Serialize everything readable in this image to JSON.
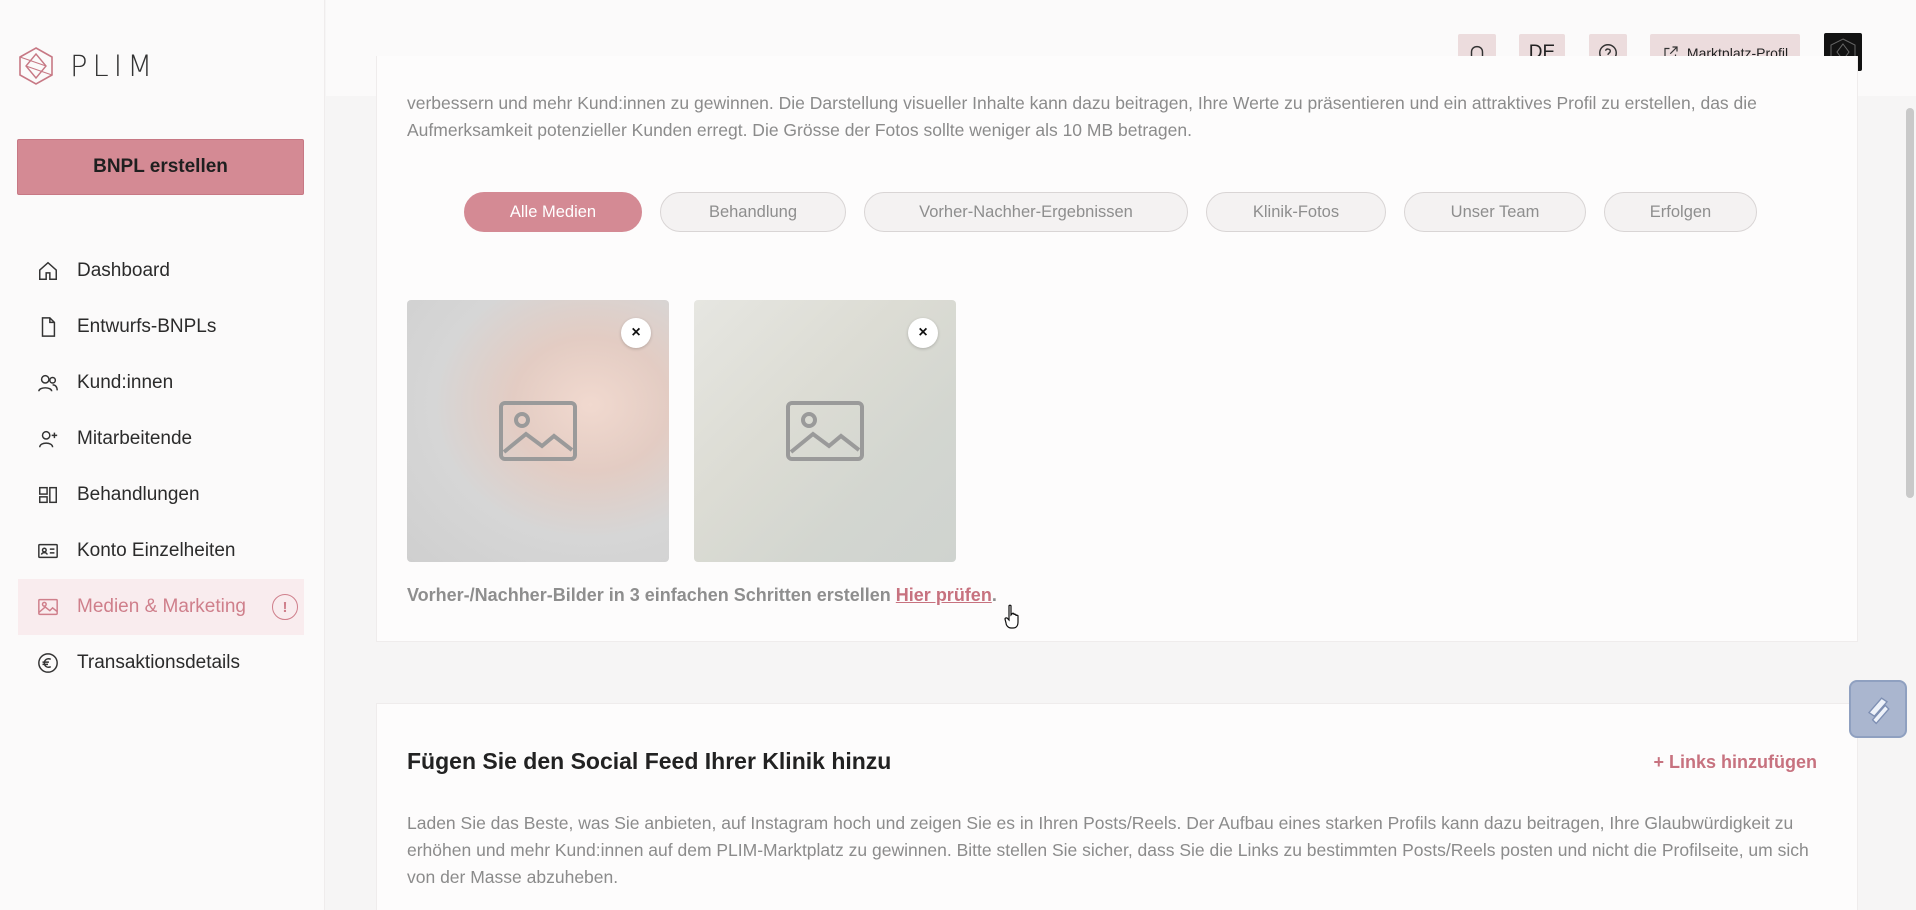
{
  "brand": {
    "name": "PLIM"
  },
  "sidebar": {
    "cta_label": "BNPL erstellen",
    "items": [
      {
        "label": "Dashboard",
        "icon": "home-icon"
      },
      {
        "label": "Entwurfs-BNPLs",
        "icon": "file-icon"
      },
      {
        "label": "Kund:innen",
        "icon": "users-icon"
      },
      {
        "label": "Mitarbeitende",
        "icon": "user-plus-icon"
      },
      {
        "label": "Behandlungen",
        "icon": "layout-icon"
      },
      {
        "label": "Konto Einzelheiten",
        "icon": "id-card-icon"
      },
      {
        "label": "Medien & Marketing",
        "icon": "image-icon",
        "active": true,
        "alert": "!"
      },
      {
        "label": "Transaktionsdetails",
        "icon": "euro-icon"
      }
    ]
  },
  "topbar": {
    "language": "DE",
    "marketplace_label": "Marktplatz-Profil"
  },
  "media": {
    "intro_text": "verbessern und mehr Kund:innen zu gewinnen. Die Darstellung visueller Inhalte kann dazu beitragen, Ihre Werte zu präsentieren und ein attraktives Profil zu erstellen, das die Aufmerksamkeit potenzieller Kunden erregt. Die Grösse der Fotos sollte weniger als 10 MB betragen.",
    "filters": [
      "Alle Medien",
      "Behandlung",
      "Vorher-Nachher-Ergebnissen",
      "Klinik-Fotos",
      "Unser Team",
      "Erfolgen"
    ],
    "active_filter": "Alle Medien",
    "remove_symbol": "×",
    "caption_text": "Vorher-/Nachher-Bilder in 3 einfachen Schritten erstellen ",
    "caption_link": "Hier prüfen",
    "caption_end": "."
  },
  "social": {
    "title": "Fügen Sie den Social Feed Ihrer Klinik hinzu",
    "add_links_label": "+ Links hinzufügen",
    "description": "Laden Sie das Beste, was Sie anbieten, auf Instagram hoch und zeigen Sie es in Ihren Posts/Reels. Der Aufbau eines starken Profils kann dazu beitragen, Ihre Glaubwürdigkeit zu erhöhen und mehr Kund:innen auf dem PLIM-Marktplatz zu gewinnen. Bitte stellen Sie sicher, dass Sie die Links zu bestimmten Posts/Reels posten und nicht die Profilseite, um sich von der Masse abzuheben."
  },
  "colors": {
    "accent": "#d48a94",
    "accent_text": "#c7727f",
    "active_bg": "#f9ecee"
  }
}
